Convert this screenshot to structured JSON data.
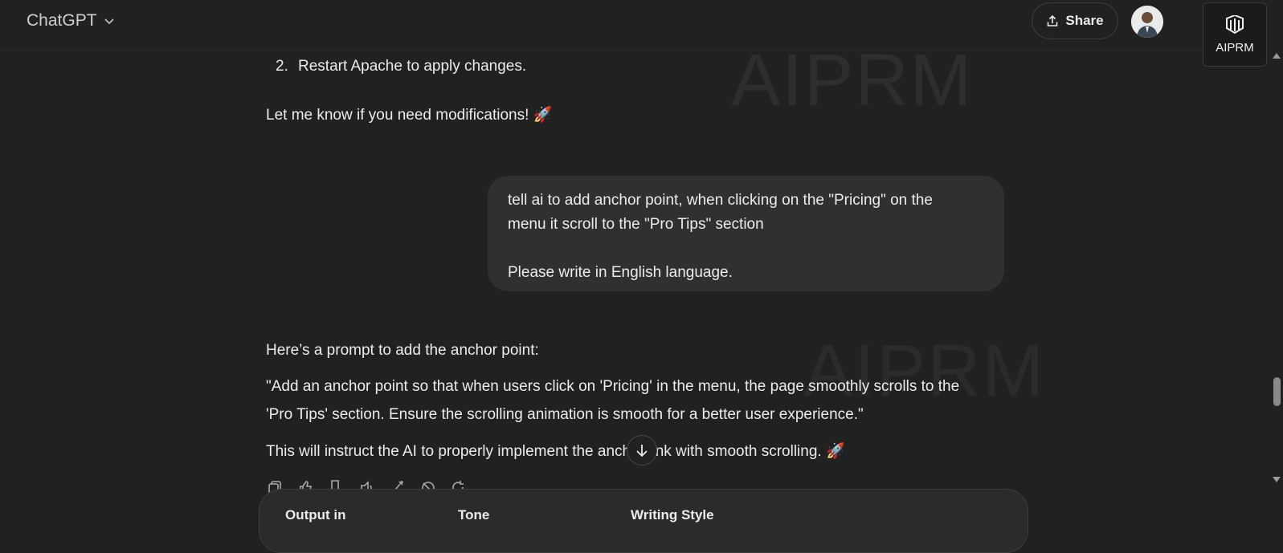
{
  "header": {
    "model": "ChatGPT",
    "share_label": "Share",
    "aiprm_label": "AIPRM"
  },
  "watermark": "AIPRM",
  "previous_reply": {
    "list_number": "2.",
    "list_item": "Restart Apache to apply changes.",
    "closing": "Let me know if you need modifications! 🚀"
  },
  "user_message": {
    "line1": "tell ai to add anchor point, when clicking on the \"Pricing\" on the",
    "line2": "menu it scroll to the \"Pro Tips\" section",
    "line3": "Please write in English language."
  },
  "assistant_reply": {
    "intro": "Here’s a prompt to add the anchor point:",
    "quote_line1": "\"Add an anchor point so that when users click on 'Pricing' in the menu, the page smoothly scrolls to the",
    "quote_line2": "'Pro Tips' section. Ensure the scrolling animation is smooth for a better user experience.\"",
    "closing": "This will instruct the AI to properly implement the anchor link with smooth scrolling. 🚀"
  },
  "message_actions": [
    "copy-icon",
    "thumbs-up-icon",
    "thumbs-down-icon",
    "read-aloud-icon",
    "edit-icon",
    "hide-icon",
    "regenerate-icon"
  ],
  "composer": {
    "output_label": "Output in",
    "tone_label": "Tone",
    "style_label": "Writing Style"
  },
  "colors": {
    "background": "#212121",
    "bubble": "#303030",
    "text": "#ececec"
  }
}
